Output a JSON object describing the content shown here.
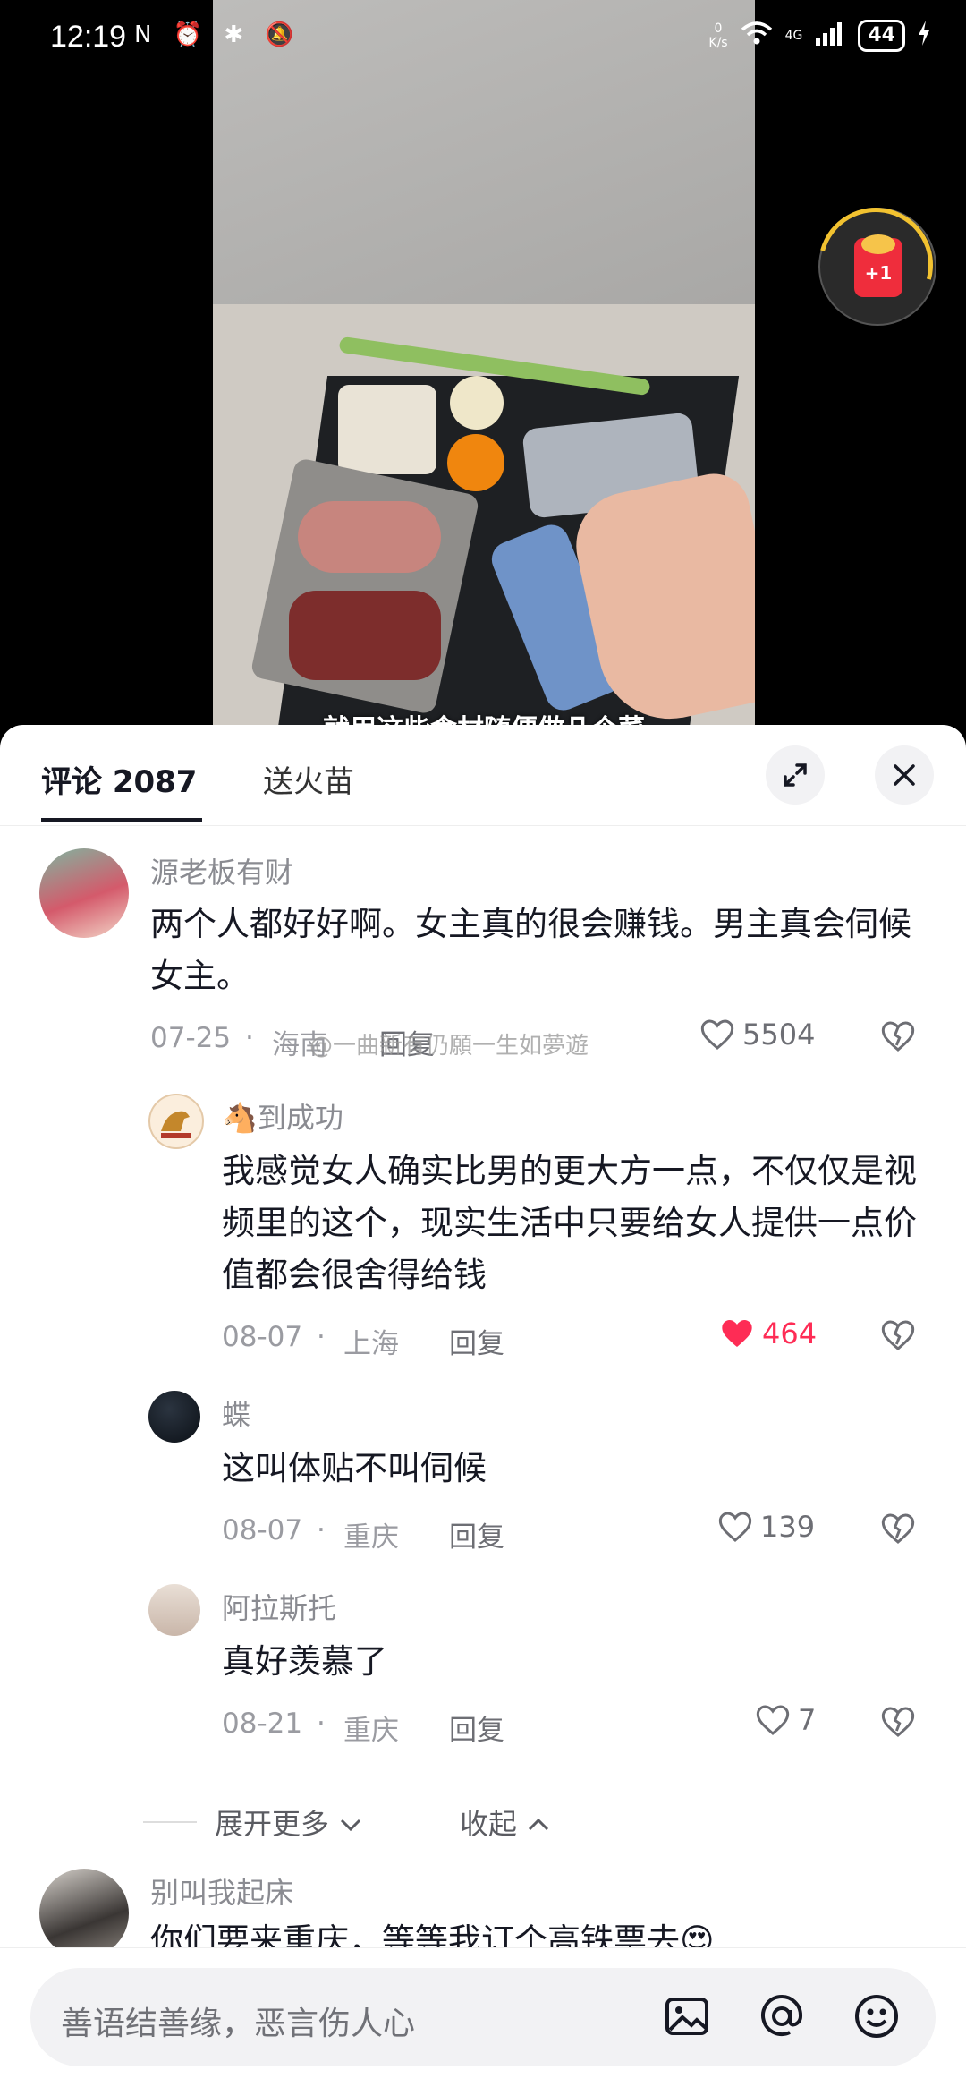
{
  "status": {
    "time": "12:19",
    "left_icons": "N ⏰ ✱ 🔕",
    "net_speed": "0\nK/s",
    "network": "4G",
    "battery": "44"
  },
  "video": {
    "subtitle": "就用这些食材随便做几个菜",
    "bonus_label": "+1"
  },
  "sheet": {
    "tab_comments": "评论 2087",
    "tab_fire": "送火苗",
    "expand_icon": "expand-icon",
    "close_icon": "close-icon"
  },
  "comments": [
    {
      "name": "源老板有财",
      "text": "两个人都好好啊。女主真的很会赚钱。男主真会伺候女主。",
      "date": "07-25",
      "location": "海南",
      "reply": "回复",
      "likes": "5504",
      "liked": false
    },
    {
      "name": "🐴到成功",
      "text": "我感觉女人确实比男的更大方一点，不仅仅是视频里的这个，现实生活中只要给女人提供一点价值都会很舍得给钱",
      "date": "08-07",
      "location": "上海",
      "reply": "回复",
      "likes": "464",
      "liked": true
    },
    {
      "name": "蝶",
      "text": "这叫体贴不叫伺候",
      "date": "08-07",
      "location": "重庆",
      "reply": "回复",
      "likes": "139",
      "liked": false
    },
    {
      "name": "阿拉斯托",
      "text": "真好羡慕了",
      "date": "08-21",
      "location": "重庆",
      "reply": "回复",
      "likes": "7",
      "liked": false
    },
    {
      "name": "别叫我起床",
      "text": "你们要来重庆，等等我订个高铁票去😍"
    }
  ],
  "expand": {
    "more": "展开更多",
    "collapse": "收起"
  },
  "watermark": "@一曲新有仍願一生如夢遊",
  "input": {
    "placeholder": "善语结善缘，恶言伤人心"
  },
  "colors": {
    "like_active": "#fe2c55",
    "text_primary": "#161823",
    "text_secondary": "#8a8b91"
  }
}
